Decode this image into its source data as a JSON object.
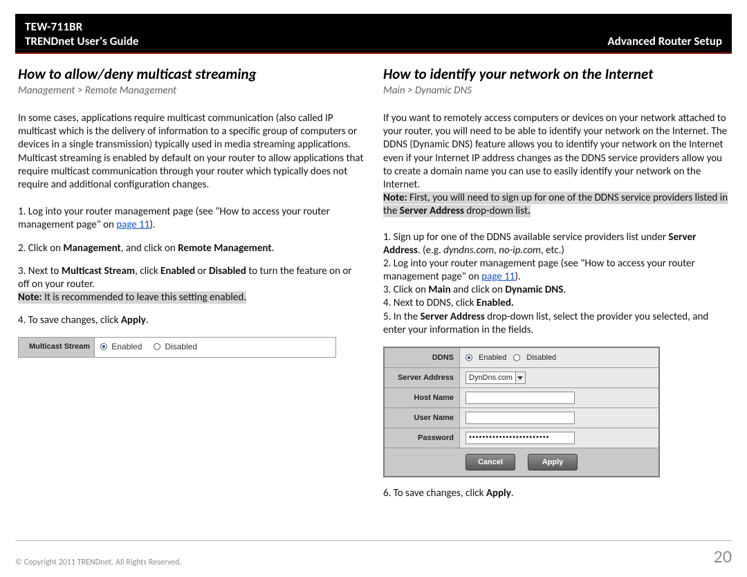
{
  "header": {
    "model": "TEW-711BR",
    "guide": "TRENDnet User's Guide",
    "section": "Advanced Router Setup"
  },
  "left": {
    "heading": "How to allow/deny multicast streaming",
    "breadcrumb": "Management > Remote Management",
    "intro": "In some cases, applications require multicast communication (also called IP multicast which is the delivery of information to a specific group of computers or devices in a single transmission) typically used in media streaming applications. Multicast streaming is enabled by default on your router to allow applications that require multicast communication through your router which typically does not require and additional configuration changes.",
    "step1_a": "1. Log into your router management page (see \"How to access your router management page\" on ",
    "step1_link": "page 11",
    "step1_b": ").",
    "step2_a": "2. Click on ",
    "step2_b1": "Management",
    "step2_c": ", and click on ",
    "step2_b2": "Remote Management",
    "step2_d": ".",
    "step3_a": "3. Next to ",
    "step3_b1": "Multicast Stream",
    "step3_b": ", click ",
    "step3_b2": "Enabled",
    "step3_c": " or ",
    "step3_b3": "Disabled",
    "step3_d": " to turn the feature on or off on your router.",
    "note_a": "Note:",
    "note_b": " It is recommended to leave this setting enabled.",
    "step4_a": "4. To save changes, click ",
    "step4_b": "Apply",
    "step4_c": ".",
    "form": {
      "label": "Multicast Stream",
      "opt_enabled": "Enabled",
      "opt_disabled": "Disabled"
    }
  },
  "right": {
    "heading": "How to identify your network on the Internet",
    "breadcrumb": "Main > Dynamic DNS",
    "intro": "If you want to remotely access computers or devices on your network attached to your router, you will need to be able to identify your network on the Internet. The DDNS (Dynamic DNS) feature allows you to identify your network on the Internet even if your Internet IP address changes as the DDNS service providers allow you to create a domain name you can use to easily identify your network on the Internet.",
    "note_a": "Note:",
    "note_b": " First, you will need to sign up for one of the DDNS service providers listed in the ",
    "note_c": "Server Address",
    "note_d": " drop-down list",
    "note_e": ".",
    "s1_a": "1. Sign up for one of the DDNS available service providers list under ",
    "s1_b": "Server Address",
    "s1_c": ". (e.g. ",
    "s1_d": "dyndns.com, no-ip.com",
    "s1_e": ", etc.)",
    "s2_a": "2. Log into your router management page (see \"How to access your router management page\" on ",
    "s2_link": "page 11",
    "s2_b": ").",
    "s3_a": "3. Click on ",
    "s3_b1": "Main",
    "s3_b": " and click on ",
    "s3_b2": "Dynamic DNS",
    "s3_c": ".",
    "s4_a": "4. Next to DDNS, click ",
    "s4_b": "Enabled.",
    "s5_a": "5. In the ",
    "s5_b": "Server Address",
    "s5_c": " drop-down list, select the provider you selected, and enter your information in the fields.",
    "form": {
      "l_ddns": "DDNS",
      "opt_enabled": "Enabled",
      "opt_disabled": "Disabled",
      "l_server": "Server Address",
      "sel_server": "DynDns.com",
      "l_host": "Host Name",
      "l_user": "User Name",
      "l_pass": "Password",
      "pw_dots": "••••••••••••••••••••••••",
      "btn_cancel": "Cancel",
      "btn_apply": "Apply"
    },
    "s6_a": "6. To save changes, click ",
    "s6_b": "Apply",
    "s6_c": "."
  },
  "footer": {
    "copyright": "© Copyright 2011 TRENDnet. All Rights Reserved.",
    "page": "20"
  }
}
